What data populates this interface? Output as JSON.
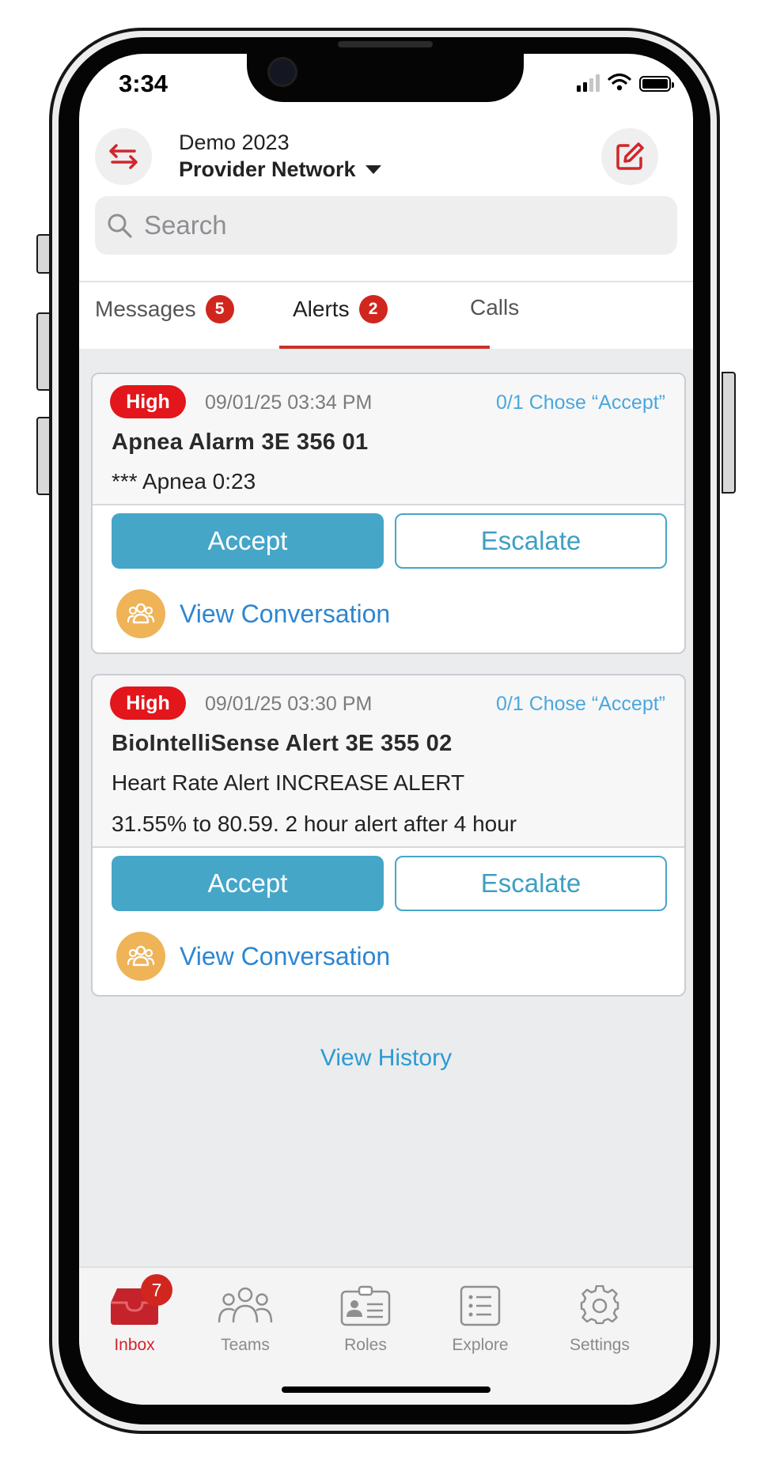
{
  "status_bar": {
    "time": "3:34"
  },
  "header": {
    "org": "Demo 2023",
    "network": "Provider Network"
  },
  "search": {
    "placeholder": "Search"
  },
  "tabs": [
    {
      "label": "Messages",
      "badge": "5"
    },
    {
      "label": "Alerts",
      "badge": "2"
    },
    {
      "label": "Calls"
    }
  ],
  "alerts": [
    {
      "priority": "High",
      "timestamp": "09/01/25 03:34 PM",
      "response": "0/1 Chose “Accept”",
      "title": "Apnea Alarm 3E 356 01",
      "lines": [
        "*** Apnea 0:23"
      ],
      "accept": "Accept",
      "escalate": "Escalate",
      "conversation": "View Conversation"
    },
    {
      "priority": "High",
      "timestamp": "09/01/25 03:30 PM",
      "response": "0/1 Chose “Accept”",
      "title": "BioIntelliSense Alert 3E 355 02",
      "lines": [
        "Heart Rate Alert INCREASE ALERT",
        "31.55% to 80.59. 2 hour alert after 4 hour"
      ],
      "accept": "Accept",
      "escalate": "Escalate",
      "conversation": "View Conversation"
    }
  ],
  "view_history": "View History",
  "nav": [
    {
      "label": "Inbox",
      "badge": "7",
      "icon": "inbox-icon",
      "active": true
    },
    {
      "label": "Teams",
      "icon": "teams-icon"
    },
    {
      "label": "Roles",
      "icon": "roles-icon"
    },
    {
      "label": "Explore",
      "icon": "explore-icon"
    },
    {
      "label": "Settings",
      "icon": "gear-icon"
    }
  ],
  "colors": {
    "brand_red": "#d0261e",
    "accept_blue": "#45a6c8",
    "link_blue": "#2d86d2",
    "conversation_orange": "#efb358"
  }
}
